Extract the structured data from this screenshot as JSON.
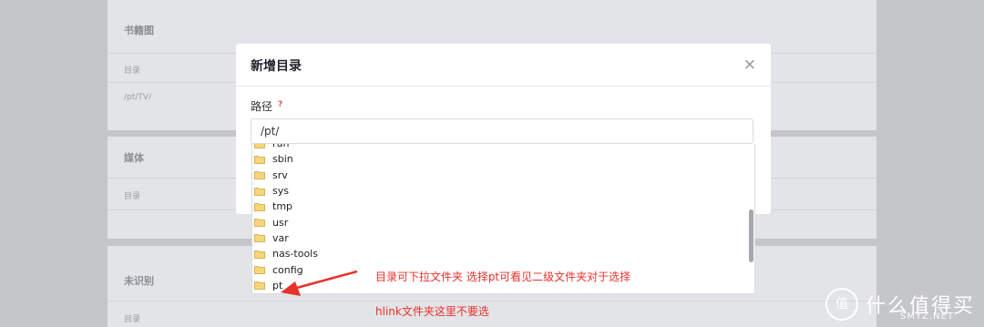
{
  "background": {
    "sections": [
      {
        "title": "书籍图",
        "sub1": "目录",
        "sub2": "/pt/TV/"
      },
      {
        "title": "媒体",
        "sub1": "目录"
      },
      {
        "title": "未识别",
        "sub1": "目录"
      }
    ]
  },
  "modal": {
    "title": "新增目录",
    "close_icon": "×",
    "path_label": "路径",
    "help_icon": "?",
    "path_value": "/pt/"
  },
  "dropdown": {
    "items": [
      {
        "label": "run",
        "icon": "folder-icon"
      },
      {
        "label": "sbin",
        "icon": "folder-icon"
      },
      {
        "label": "srv",
        "icon": "folder-icon"
      },
      {
        "label": "sys",
        "icon": "folder-icon"
      },
      {
        "label": "tmp",
        "icon": "folder-icon"
      },
      {
        "label": "usr",
        "icon": "folder-icon"
      },
      {
        "label": "var",
        "icon": "folder-icon"
      },
      {
        "label": "nas-tools",
        "icon": "folder-icon"
      },
      {
        "label": "config",
        "icon": "folder-icon"
      },
      {
        "label": "pt",
        "icon": "folder-icon"
      }
    ]
  },
  "annotations": {
    "note1": "目录可下拉文件夹 选择pt可看见二级文件夹对于选择",
    "note2": "hlink文件夹这里不要选",
    "color": "#e8312c"
  },
  "watermark": {
    "icon": "值",
    "text": "什么值得买",
    "sub": "SMYZ.NET"
  }
}
